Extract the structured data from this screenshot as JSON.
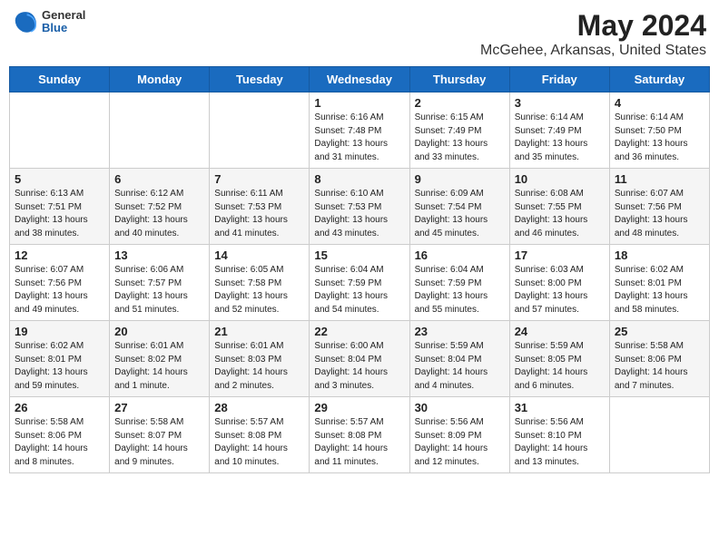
{
  "header": {
    "logo_general": "General",
    "logo_blue": "Blue",
    "title": "May 2024",
    "subtitle": "McGehee, Arkansas, United States"
  },
  "calendar": {
    "days_of_week": [
      "Sunday",
      "Monday",
      "Tuesday",
      "Wednesday",
      "Thursday",
      "Friday",
      "Saturday"
    ],
    "weeks": [
      [
        {
          "day": "",
          "info": ""
        },
        {
          "day": "",
          "info": ""
        },
        {
          "day": "",
          "info": ""
        },
        {
          "day": "1",
          "info": "Sunrise: 6:16 AM\nSunset: 7:48 PM\nDaylight: 13 hours\nand 31 minutes."
        },
        {
          "day": "2",
          "info": "Sunrise: 6:15 AM\nSunset: 7:49 PM\nDaylight: 13 hours\nand 33 minutes."
        },
        {
          "day": "3",
          "info": "Sunrise: 6:14 AM\nSunset: 7:49 PM\nDaylight: 13 hours\nand 35 minutes."
        },
        {
          "day": "4",
          "info": "Sunrise: 6:14 AM\nSunset: 7:50 PM\nDaylight: 13 hours\nand 36 minutes."
        }
      ],
      [
        {
          "day": "5",
          "info": "Sunrise: 6:13 AM\nSunset: 7:51 PM\nDaylight: 13 hours\nand 38 minutes."
        },
        {
          "day": "6",
          "info": "Sunrise: 6:12 AM\nSunset: 7:52 PM\nDaylight: 13 hours\nand 40 minutes."
        },
        {
          "day": "7",
          "info": "Sunrise: 6:11 AM\nSunset: 7:53 PM\nDaylight: 13 hours\nand 41 minutes."
        },
        {
          "day": "8",
          "info": "Sunrise: 6:10 AM\nSunset: 7:53 PM\nDaylight: 13 hours\nand 43 minutes."
        },
        {
          "day": "9",
          "info": "Sunrise: 6:09 AM\nSunset: 7:54 PM\nDaylight: 13 hours\nand 45 minutes."
        },
        {
          "day": "10",
          "info": "Sunrise: 6:08 AM\nSunset: 7:55 PM\nDaylight: 13 hours\nand 46 minutes."
        },
        {
          "day": "11",
          "info": "Sunrise: 6:07 AM\nSunset: 7:56 PM\nDaylight: 13 hours\nand 48 minutes."
        }
      ],
      [
        {
          "day": "12",
          "info": "Sunrise: 6:07 AM\nSunset: 7:56 PM\nDaylight: 13 hours\nand 49 minutes."
        },
        {
          "day": "13",
          "info": "Sunrise: 6:06 AM\nSunset: 7:57 PM\nDaylight: 13 hours\nand 51 minutes."
        },
        {
          "day": "14",
          "info": "Sunrise: 6:05 AM\nSunset: 7:58 PM\nDaylight: 13 hours\nand 52 minutes."
        },
        {
          "day": "15",
          "info": "Sunrise: 6:04 AM\nSunset: 7:59 PM\nDaylight: 13 hours\nand 54 minutes."
        },
        {
          "day": "16",
          "info": "Sunrise: 6:04 AM\nSunset: 7:59 PM\nDaylight: 13 hours\nand 55 minutes."
        },
        {
          "day": "17",
          "info": "Sunrise: 6:03 AM\nSunset: 8:00 PM\nDaylight: 13 hours\nand 57 minutes."
        },
        {
          "day": "18",
          "info": "Sunrise: 6:02 AM\nSunset: 8:01 PM\nDaylight: 13 hours\nand 58 minutes."
        }
      ],
      [
        {
          "day": "19",
          "info": "Sunrise: 6:02 AM\nSunset: 8:01 PM\nDaylight: 13 hours\nand 59 minutes."
        },
        {
          "day": "20",
          "info": "Sunrise: 6:01 AM\nSunset: 8:02 PM\nDaylight: 14 hours\nand 1 minute."
        },
        {
          "day": "21",
          "info": "Sunrise: 6:01 AM\nSunset: 8:03 PM\nDaylight: 14 hours\nand 2 minutes."
        },
        {
          "day": "22",
          "info": "Sunrise: 6:00 AM\nSunset: 8:04 PM\nDaylight: 14 hours\nand 3 minutes."
        },
        {
          "day": "23",
          "info": "Sunrise: 5:59 AM\nSunset: 8:04 PM\nDaylight: 14 hours\nand 4 minutes."
        },
        {
          "day": "24",
          "info": "Sunrise: 5:59 AM\nSunset: 8:05 PM\nDaylight: 14 hours\nand 6 minutes."
        },
        {
          "day": "25",
          "info": "Sunrise: 5:58 AM\nSunset: 8:06 PM\nDaylight: 14 hours\nand 7 minutes."
        }
      ],
      [
        {
          "day": "26",
          "info": "Sunrise: 5:58 AM\nSunset: 8:06 PM\nDaylight: 14 hours\nand 8 minutes."
        },
        {
          "day": "27",
          "info": "Sunrise: 5:58 AM\nSunset: 8:07 PM\nDaylight: 14 hours\nand 9 minutes."
        },
        {
          "day": "28",
          "info": "Sunrise: 5:57 AM\nSunset: 8:08 PM\nDaylight: 14 hours\nand 10 minutes."
        },
        {
          "day": "29",
          "info": "Sunrise: 5:57 AM\nSunset: 8:08 PM\nDaylight: 14 hours\nand 11 minutes."
        },
        {
          "day": "30",
          "info": "Sunrise: 5:56 AM\nSunset: 8:09 PM\nDaylight: 14 hours\nand 12 minutes."
        },
        {
          "day": "31",
          "info": "Sunrise: 5:56 AM\nSunset: 8:10 PM\nDaylight: 14 hours\nand 13 minutes."
        },
        {
          "day": "",
          "info": ""
        }
      ]
    ]
  }
}
